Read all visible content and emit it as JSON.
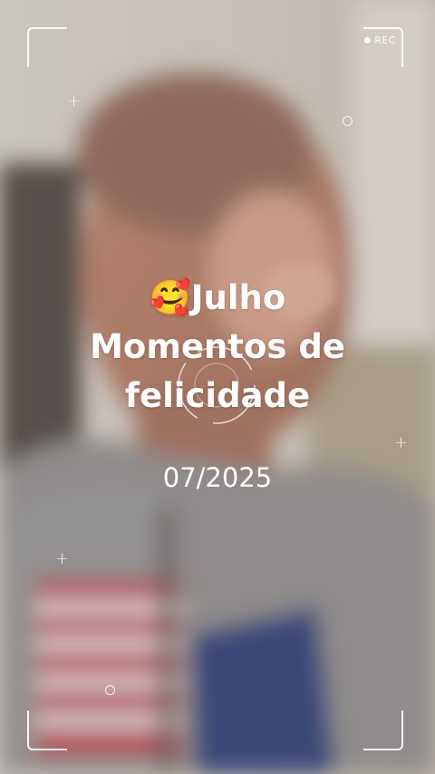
{
  "recorder": {
    "rec_label": "REC",
    "icon": "rec-dot-icon"
  },
  "overlay": {
    "emoji": "🥰",
    "title_line1": "Julho",
    "title_line2": "Momentos de",
    "title_line3": "felicidade",
    "date": "07/2025"
  },
  "decorations": {
    "plus_glyph": "+",
    "icons": [
      "viewfinder-corner-icon",
      "plus-sparkle-icon",
      "ring-sparkle-icon",
      "focus-ring-icon"
    ]
  },
  "colors": {
    "overlay_text": "#ffffff",
    "background": "#b9b3a8"
  }
}
